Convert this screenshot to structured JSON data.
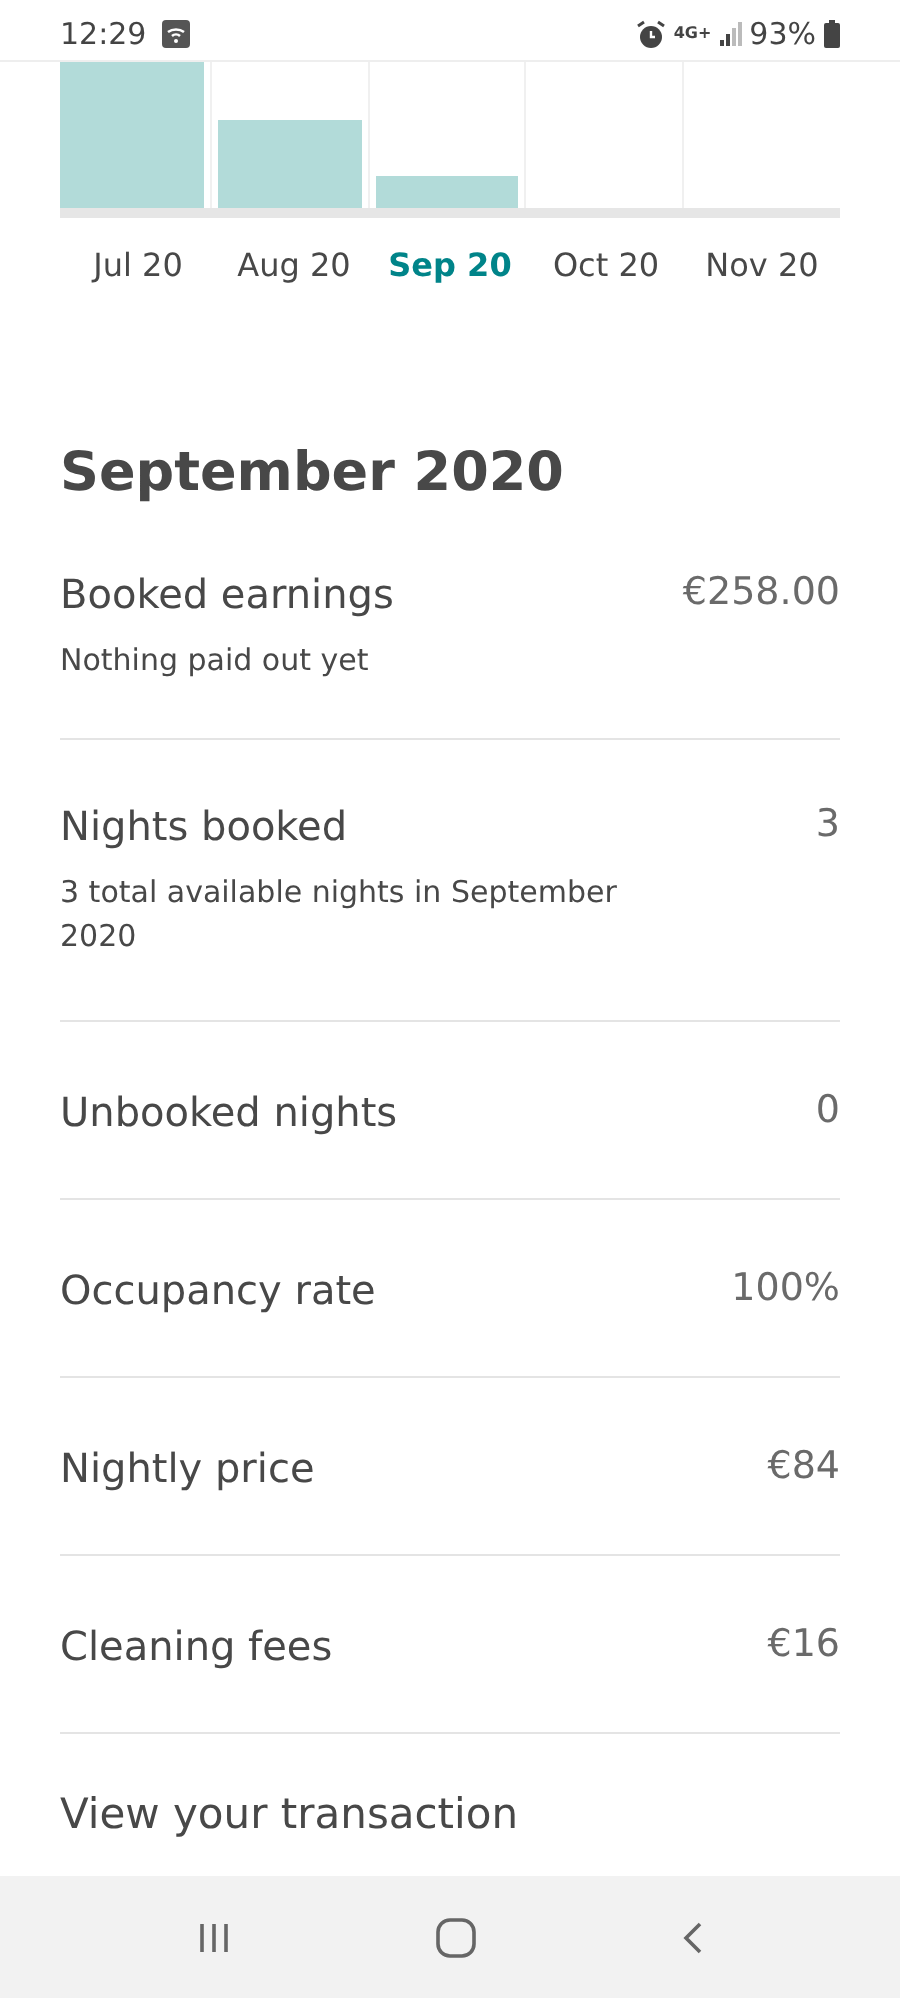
{
  "status_bar": {
    "time": "12:29",
    "network": "4G+",
    "battery": "93%"
  },
  "chart": {
    "months": [
      {
        "label": "Jul 20",
        "selected": false
      },
      {
        "label": "Aug 20",
        "selected": false
      },
      {
        "label": "Sep 20",
        "selected": true
      },
      {
        "label": "Oct 20",
        "selected": false
      },
      {
        "label": "Nov 20",
        "selected": false
      }
    ]
  },
  "title": "September 2020",
  "rows": [
    {
      "label": "Booked earnings",
      "value": "€258.00",
      "note": "Nothing paid out yet"
    },
    {
      "label": "Nights booked",
      "value": "3",
      "note": "3 total available nights in September 2020"
    },
    {
      "label": "Unbooked nights",
      "value": "0"
    },
    {
      "label": "Occupancy rate",
      "value": "100%"
    },
    {
      "label": "Nightly price",
      "value": "€84"
    },
    {
      "label": "Cleaning fees",
      "value": "€16"
    }
  ],
  "link": "View your transaction"
}
